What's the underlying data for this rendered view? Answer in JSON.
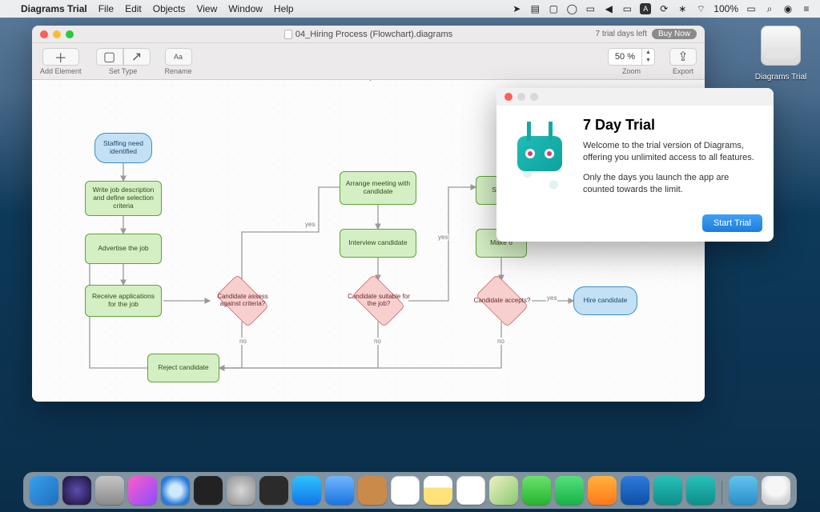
{
  "menubar": {
    "app_name": "Diagrams Trial",
    "items": [
      "File",
      "Edit",
      "Objects",
      "View",
      "Window",
      "Help"
    ],
    "battery_pct": "100%"
  },
  "desktop_icon": {
    "label": "Diagrams Trial"
  },
  "editor": {
    "document_title": "04_Hiring Process (Flowchart).diagrams",
    "trial_text": "7 trial days left",
    "buy_button": "Buy Now",
    "toolbar": {
      "add_element": "Add Element",
      "set_type": "Set Type",
      "rename": "Rename",
      "rename_icon_text": "Aa",
      "zoom_value": "50 %",
      "zoom_label": "Zoom",
      "export_label": "Export"
    }
  },
  "flowchart": {
    "terminator_start": "Staffing need identified",
    "process_write_jd": "Write job description and define selection criteria",
    "process_advertise": "Advertise the job",
    "process_receive_apps": "Receive applications for the job",
    "decision_assess": "Candidate assess against criteria?",
    "process_reject": "Reject candidate",
    "process_arrange_meeting": "Arrange meeting with candidate",
    "process_interview": "Interview candidate",
    "decision_suitable": "Candidate suitable for the job?",
    "process_select": "Select",
    "process_make_offer": "Make o",
    "decision_accepts": "Candidate accepts?",
    "terminator_hire": "Hire candidate",
    "label_yes": "yes",
    "label_no": "no"
  },
  "trial_dialog": {
    "title": "7 Day Trial",
    "paragraph1": "Welcome to the trial version of Diagrams, offering you unlimited access to all features.",
    "paragraph2": "Only the days you launch the app are counted towards the limit.",
    "start_button": "Start Trial"
  },
  "dock": {
    "item_count": 23
  }
}
